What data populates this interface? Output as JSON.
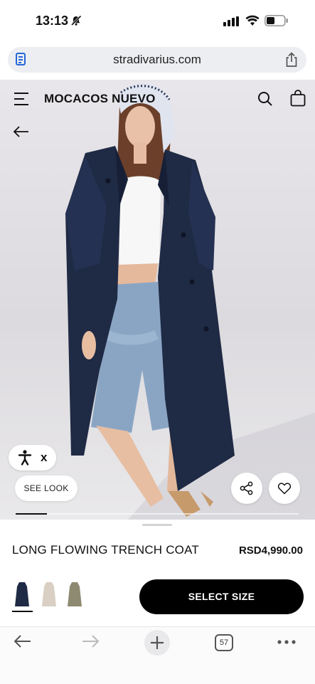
{
  "status_bar": {
    "time": "13:13"
  },
  "browser": {
    "url": "stradivarius.com",
    "tab_count": "57"
  },
  "header": {
    "brand": "MOCACOS NUEVO"
  },
  "hero": {
    "see_look_label": "SEE LOOK",
    "accessibility_close": "x",
    "image_progress": 0.11
  },
  "product": {
    "name": "LONG FLOWING TRENCH COAT",
    "price": "RSD4,990.00",
    "colors": [
      {
        "name": "navy",
        "hex": "#1f2a44",
        "selected": true
      },
      {
        "name": "beige",
        "hex": "#d9cfc2",
        "selected": false
      },
      {
        "name": "khaki",
        "hex": "#8e8a72",
        "selected": false
      }
    ],
    "select_size_label": "SELECT SIZE"
  },
  "colors": {
    "accent": "#000000",
    "link_blue": "#2468d8",
    "coat_navy": "#1f2a44"
  }
}
